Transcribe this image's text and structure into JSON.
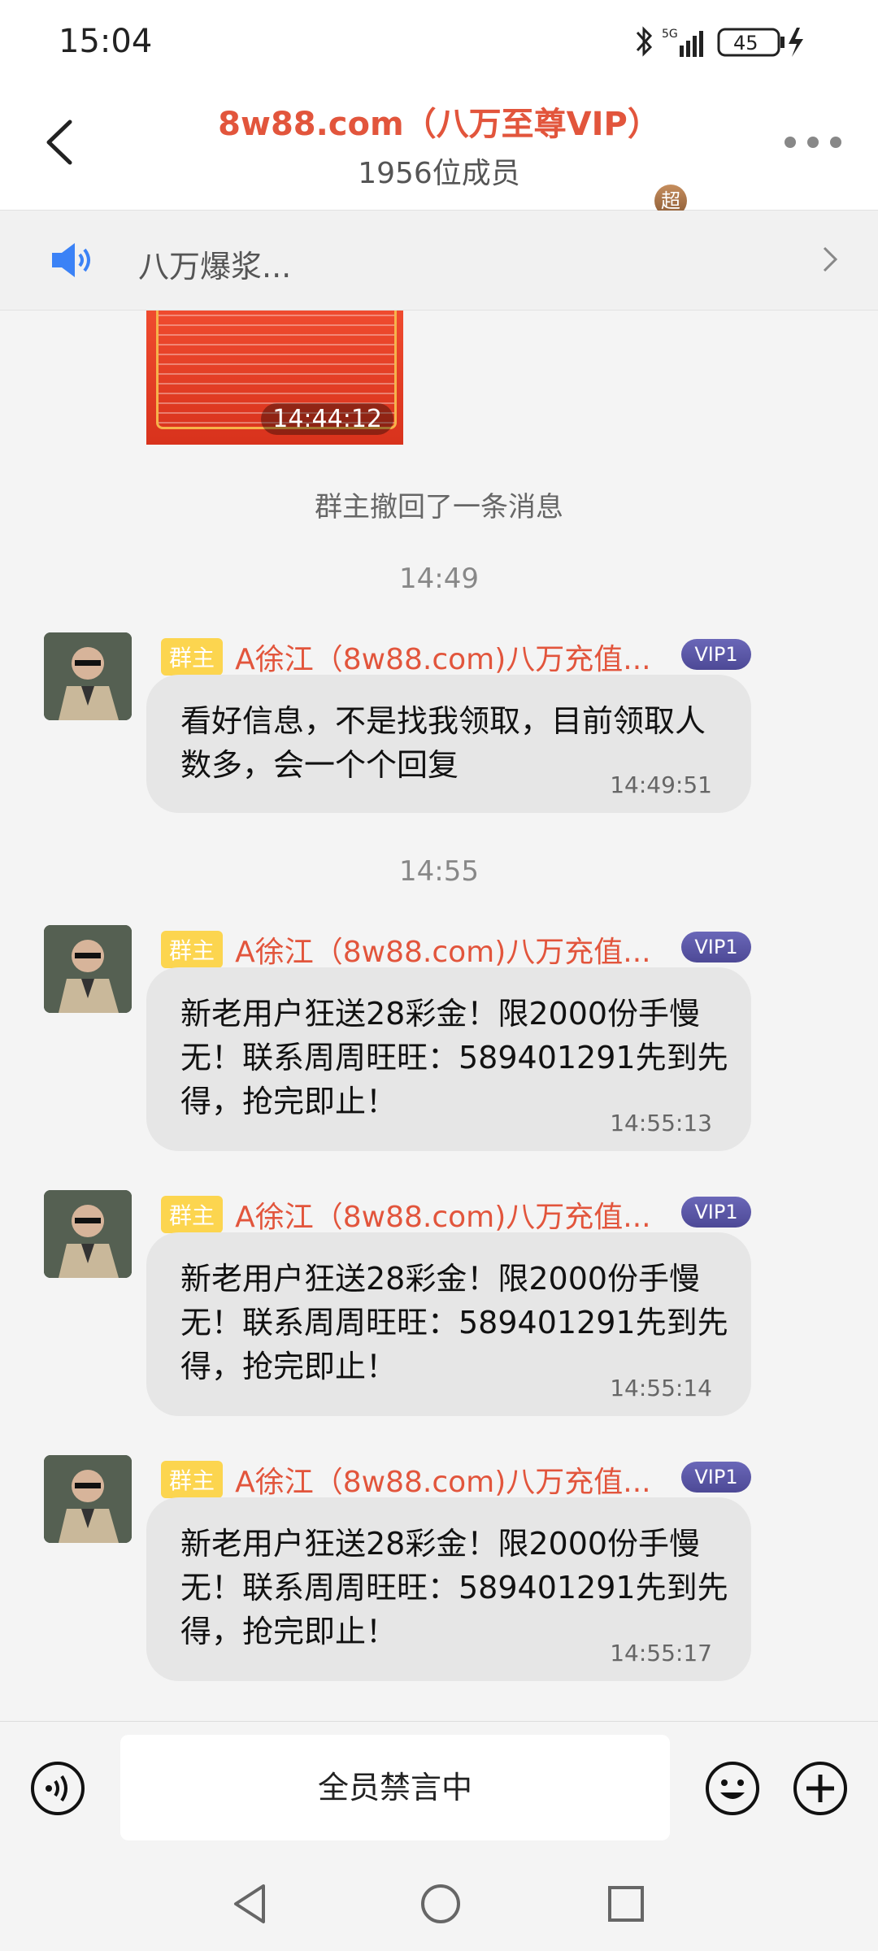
{
  "status_bar": {
    "time": "15:04",
    "signal_label": "5G",
    "battery": "45"
  },
  "header": {
    "title": "8w88.com（八万至尊VIP）",
    "super_badge": "超",
    "member_count": "1956位成员"
  },
  "notice": {
    "text": "八万爆浆..."
  },
  "chat": {
    "image_message": {
      "time": "14:44:12"
    },
    "system_message": "群主撤回了一条消息",
    "separators": [
      "14:49",
      "14:55"
    ],
    "messages": [
      {
        "role": "群主",
        "sender": "A徐江（8w88.com)八万充值...",
        "vip": "VIP1",
        "text": "看好信息，不是找我领取，目前领取人数多，会一个个回复",
        "time": "14:49:51"
      },
      {
        "role": "群主",
        "sender": "A徐江（8w88.com)八万充值...",
        "vip": "VIP1",
        "text": "新老用户狂送28彩金！限2000份手慢无！联系周周旺旺：589401291先到先得，抢完即止！",
        "time": "14:55:13"
      },
      {
        "role": "群主",
        "sender": "A徐江（8w88.com)八万充值...",
        "vip": "VIP1",
        "text": "新老用户狂送28彩金！限2000份手慢无！联系周周旺旺：589401291先到先得，抢完即止！",
        "time": "14:55:14"
      },
      {
        "role": "群主",
        "sender": "A徐江（8w88.com)八万充值...",
        "vip": "VIP1",
        "text": "新老用户狂送28彩金！限2000份手慢无！联系周周旺旺：589401291先到先得，抢完即止！",
        "time": "14:55:17"
      }
    ]
  },
  "input_bar": {
    "placeholder": "全员禁言中"
  },
  "colors": {
    "accent": "#e2553c",
    "badge_yellow": "#fcd54f",
    "vip_purple": "#5b57a6",
    "bubble": "#e6e6e6"
  }
}
